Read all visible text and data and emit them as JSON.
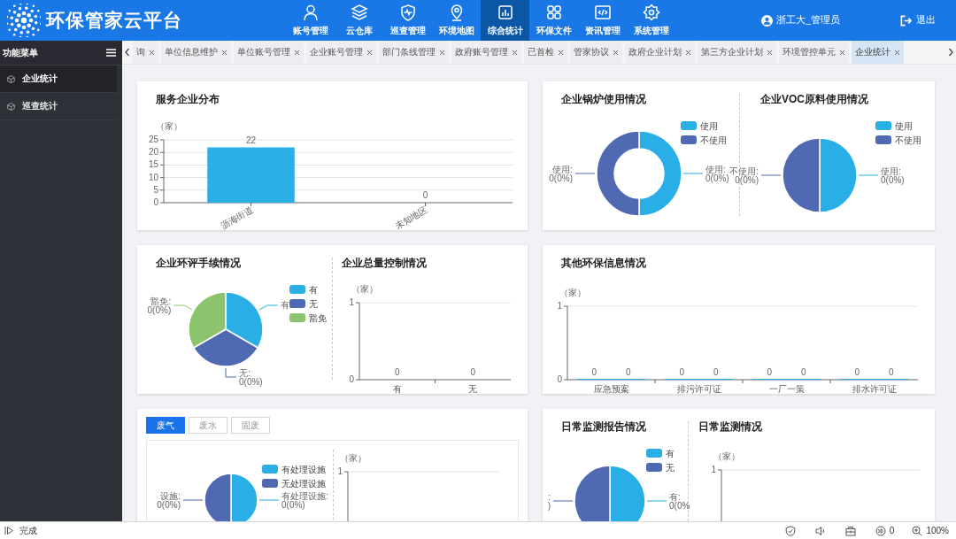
{
  "header": {
    "title": "环保管家云平台",
    "nav": [
      {
        "label": "账号管理",
        "selected": false
      },
      {
        "label": "云仓库",
        "selected": false
      },
      {
        "label": "巡查管理",
        "selected": false
      },
      {
        "label": "环境地图",
        "selected": false
      },
      {
        "label": "综合统计",
        "selected": true
      },
      {
        "label": "环保文件",
        "selected": false
      },
      {
        "label": "资讯管理",
        "selected": false
      },
      {
        "label": "系统管理",
        "selected": false
      }
    ],
    "user": "浙工大_管理员",
    "logout": "退出"
  },
  "sidebar": {
    "title": "功能菜单",
    "items": [
      {
        "label": "企业统计",
        "selected": true
      },
      {
        "label": "巡查统计",
        "selected": false
      }
    ]
  },
  "tabs": [
    {
      "label": "询",
      "selected": false
    },
    {
      "label": "单位信息维护",
      "selected": false
    },
    {
      "label": "单位账号管理",
      "selected": false
    },
    {
      "label": "企业账号管理",
      "selected": false
    },
    {
      "label": "部门条线管理",
      "selected": false
    },
    {
      "label": "政府账号管理",
      "selected": false
    },
    {
      "label": "已首检",
      "selected": false
    },
    {
      "label": "管家协议",
      "selected": false
    },
    {
      "label": "政府企业计划",
      "selected": false
    },
    {
      "label": "第三方企业计划",
      "selected": false
    },
    {
      "label": "环境管控单元",
      "selected": false
    },
    {
      "label": "企业统计",
      "selected": true
    }
  ],
  "cards": [
    {
      "panels": [
        {
          "chart_data": {
            "type": "bar",
            "title": "服务企业分布",
            "ylabel": "（家）",
            "categories": [
              "沥海街道",
              "未知地区"
            ],
            "series": [
              {
                "color": "#29aee6",
                "values": [
                  22,
                  0
                ]
              }
            ],
            "grid": true,
            "ylim": [
              0,
              25
            ],
            "yticks": [
              0,
              5,
              10,
              15,
              20,
              25
            ],
            "data_labels": true
          }
        }
      ]
    },
    {
      "panels": [
        {
          "kind": "donut",
          "title": "企业锅炉使用情况",
          "legend": [
            {
              "label": "使用",
              "color": "#29aee6"
            },
            {
              "label": "不使用",
              "color": "#4f6ab3"
            }
          ],
          "slice_labels": [
            [
              "使用:",
              "0(0%)"
            ],
            [
              "使用:",
              "0(0%)"
            ]
          ]
        },
        {
          "kind": "pie",
          "title": "企业VOC原料使用情况",
          "legend": [
            {
              "label": "使用",
              "color": "#29aee6"
            },
            {
              "label": "不使用",
              "color": "#4f6ab3"
            }
          ],
          "slice_labels": [
            [
              "不使用:",
              "0(0%)"
            ],
            [
              "使用:",
              "0(0%)"
            ]
          ]
        }
      ]
    },
    {
      "panels": [
        {
          "kind": "pie",
          "title": "企业环评手续情况",
          "legend": [
            {
              "label": "有",
              "color": "#29aee6"
            },
            {
              "label": "无",
              "color": "#4f6ab3"
            },
            {
              "label": "豁免",
              "color": "#8cc46e"
            }
          ],
          "slice_labels": [
            [
              "豁免:",
              "0(0%)"
            ],
            [
              "有:"
            ],
            [
              "无:",
              "0(0%)"
            ]
          ]
        },
        {
          "chart_data": {
            "type": "bar",
            "title": "企业总量控制情况",
            "ylabel": "（家）",
            "categories": [
              "有",
              "无"
            ],
            "series": [
              {
                "values": [
                  0,
                  0
                ]
              }
            ],
            "ylim": [
              0,
              1
            ],
            "yticks": [
              0,
              1
            ],
            "data_labels": true
          }
        }
      ]
    },
    {
      "panels": [
        {
          "chart_data": {
            "type": "bar",
            "title": "其他环保信息情况",
            "ylabel": "（家）",
            "categories": [
              "应急预案",
              "排污许可证",
              "一厂一策",
              "排水许可证"
            ],
            "series": [
              {
                "values": [
                  0,
                  0,
                  0,
                  0
                ]
              },
              {
                "values": [
                  0,
                  0,
                  0,
                  0
                ]
              }
            ],
            "ylim": [
              0,
              1
            ],
            "yticks": [
              0,
              1
            ],
            "data_labels": true
          }
        }
      ]
    },
    {
      "tabs": [
        {
          "label": "废气",
          "selected": true
        },
        {
          "label": "废水",
          "selected": false
        },
        {
          "label": "固废",
          "selected": false
        }
      ],
      "panels": [
        {
          "kind": "pie",
          "legend": [
            {
              "label": "有处理设施",
              "color": "#29aee6"
            },
            {
              "label": "无处理设施",
              "color": "#4f6ab3"
            }
          ],
          "slice_labels": [
            [
              "设施:",
              "0(0%)"
            ],
            [
              "有处理设施:",
              "0(0%)"
            ]
          ]
        },
        {
          "chart_data": {
            "type": "other",
            "ylabel": "（家）",
            "annotations": [
              {
                "text": "1"
              }
            ]
          }
        }
      ]
    },
    {
      "panels": [
        {
          "kind": "pie",
          "title": "日常监测报告情况",
          "legend": [
            {
              "label": "有",
              "color": "#29aee6"
            },
            {
              "label": "无",
              "color": "#4f6ab3"
            }
          ],
          "slice_labels": [
            [
              ":",
              ")"
            ],
            [
              "有:",
              "0(0%"
            ]
          ]
        },
        {
          "chart_data": {
            "type": "other",
            "title": "日常监测情况",
            "ylabel": "（家）",
            "annotations": [
              {
                "text": "1"
              }
            ]
          }
        }
      ]
    }
  ],
  "status_bar": {
    "text": "完成",
    "count": "0",
    "zoom": "100%"
  }
}
